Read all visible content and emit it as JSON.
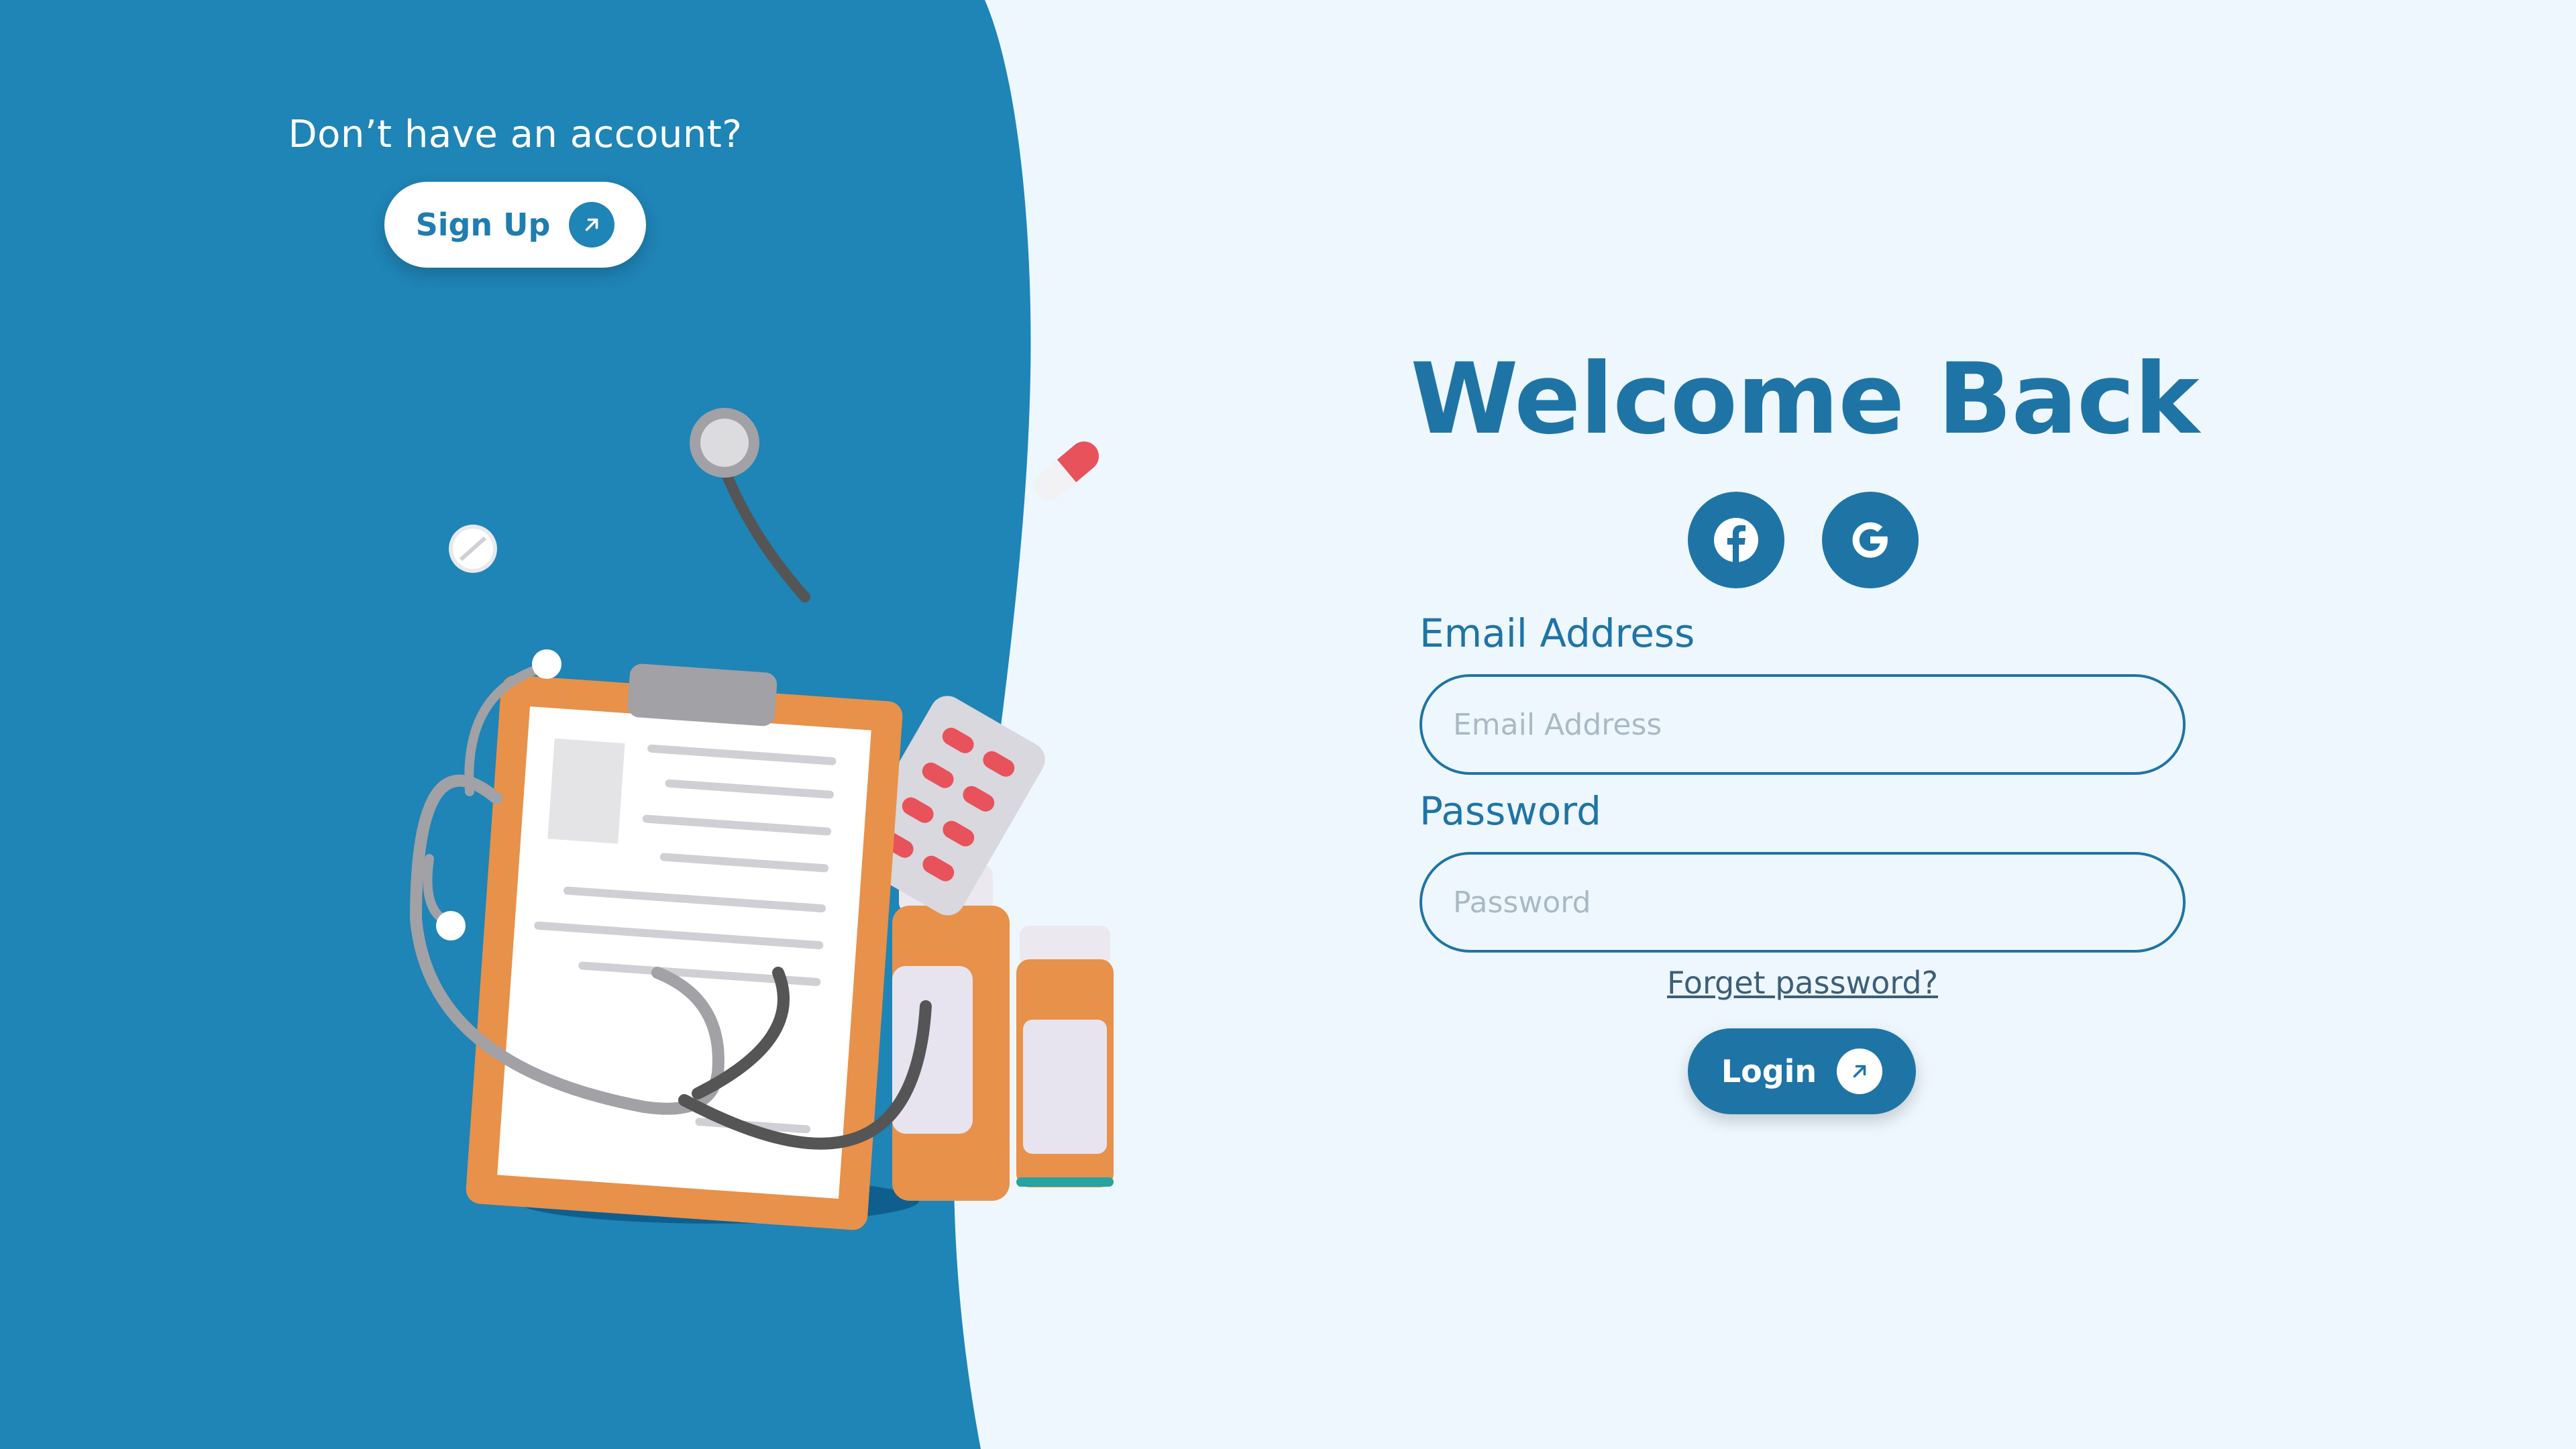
{
  "colors": {
    "primary_blue": "#1f84b6",
    "heading_blue": "#1f74a6",
    "background": "#eef7fe",
    "accent_orange": "#e8914a",
    "pill_red": "#e8525a"
  },
  "signup": {
    "prompt": "Don’t have an account?",
    "button_label": "Sign Up",
    "icon": "arrow-up-right-icon"
  },
  "login_form": {
    "title": "Welcome Back",
    "social": [
      {
        "name": "facebook",
        "icon": "facebook-icon"
      },
      {
        "name": "google",
        "icon": "google-icon"
      }
    ],
    "email": {
      "label": "Email Address",
      "placeholder": "Email Address",
      "value": ""
    },
    "password": {
      "label": "Password",
      "placeholder": "Password",
      "value": ""
    },
    "forgot_link": "Forget password?",
    "submit_label": "Login",
    "submit_icon": "arrow-up-right-icon"
  },
  "illustration": {
    "subject": "medical-clipboard-stethoscope-illustration"
  }
}
